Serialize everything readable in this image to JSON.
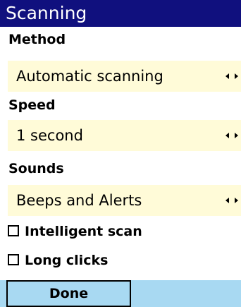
{
  "title": "Scanning",
  "method": {
    "label": "Method",
    "value": "Automatic scanning"
  },
  "speed": {
    "label": "Speed",
    "value": "1 second"
  },
  "sounds": {
    "label": "Sounds",
    "value": "Beeps and Alerts"
  },
  "options": {
    "intelligent_scan": {
      "label": "Intelligent scan",
      "checked": false
    },
    "long_clicks": {
      "label": "Long clicks",
      "checked": false
    }
  },
  "softkeys": {
    "done_label": "Done"
  },
  "icons": {
    "arrow_left": "arrow-left-icon",
    "arrow_right": "arrow-right-icon"
  },
  "colors": {
    "title_background": "#10107e",
    "selector_background": "#fffbd8",
    "softkey_background": "#a8d9f2"
  }
}
